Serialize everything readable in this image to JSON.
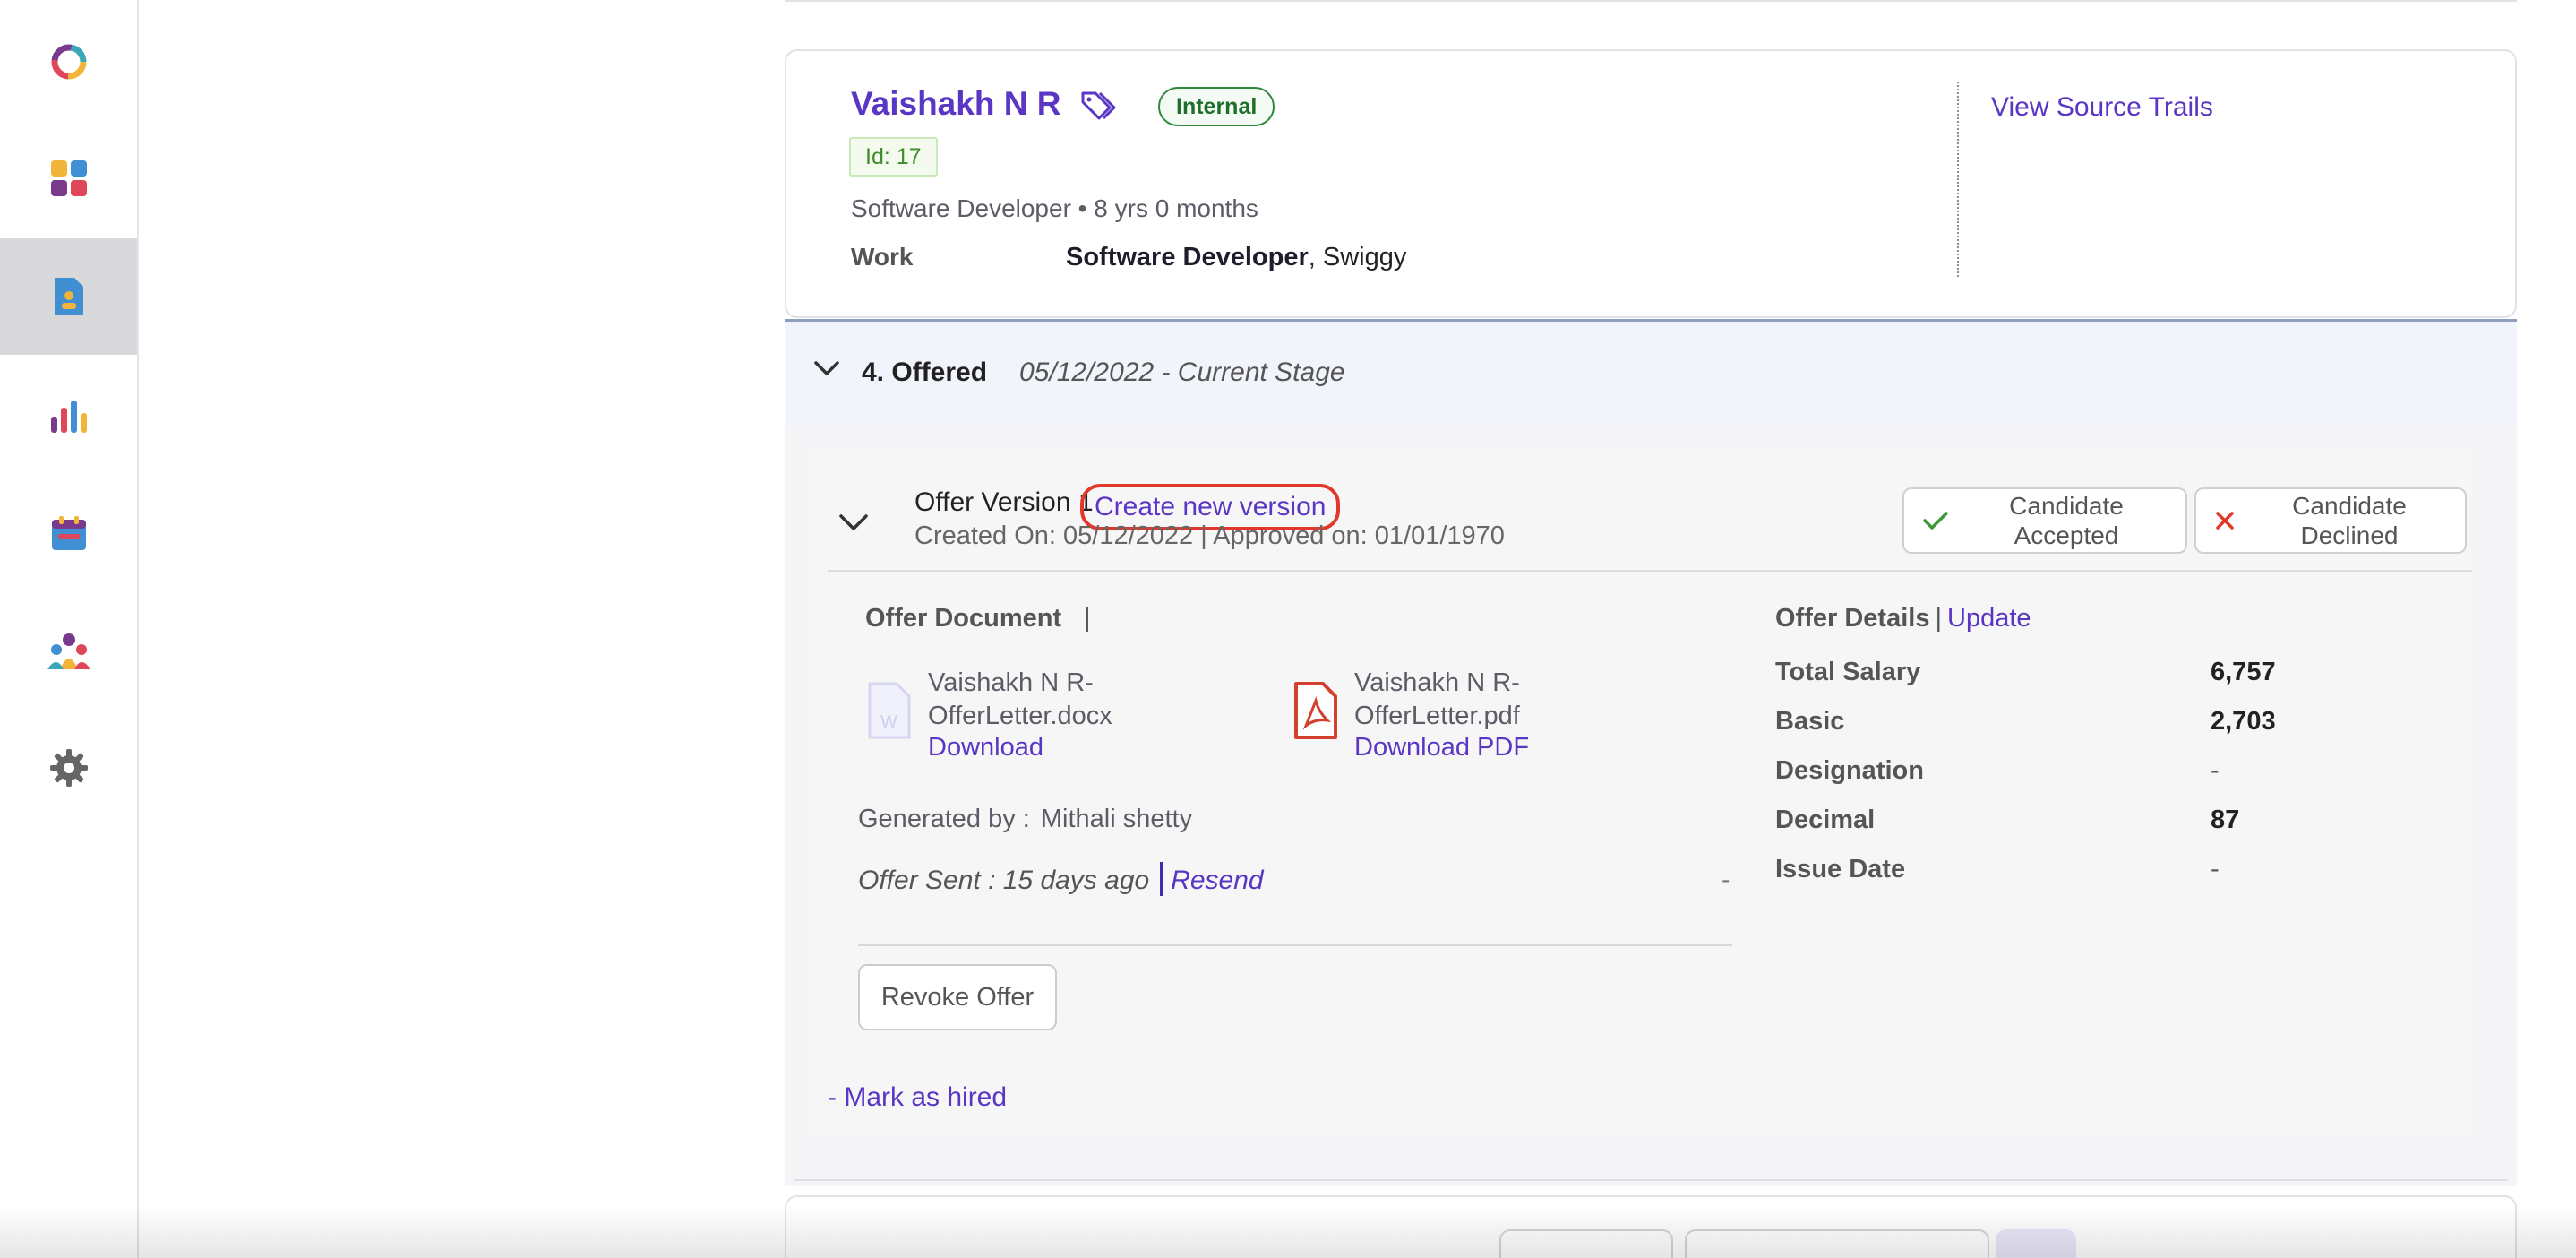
{
  "rail": {
    "items": [
      {
        "icon": "logo-ring-icon"
      },
      {
        "icon": "dashboard-grid-icon"
      },
      {
        "icon": "candidate-document-icon",
        "active": true
      },
      {
        "icon": "analytics-bars-icon"
      },
      {
        "icon": "calendar-icon"
      },
      {
        "icon": "team-people-icon"
      },
      {
        "icon": "settings-gear-icon"
      }
    ],
    "colors": {
      "purple": "#7a3a8c",
      "yellow": "#f2b53a",
      "red": "#e0465a",
      "blue": "#3f8fd2",
      "teal": "#3aa8b8"
    }
  },
  "candidate": {
    "name": "Vaishakh N R",
    "internal_badge": "Internal",
    "id_label": "Id: 17",
    "role_summary": "Software Developer • 8 yrs 0 months",
    "work_label": "Work",
    "work_title": "Software Developer",
    "work_company": ", Swiggy",
    "source_trails_link": "View Source Trails"
  },
  "stage": {
    "title": "4. Offered",
    "date_status": "05/12/2022 - Current Stage"
  },
  "offer": {
    "version_label": "Offer Version 1",
    "create_version_link": "Create new version",
    "created_approved": "Created On: 05/12/2022 | Approved on: 01/01/1970",
    "accept_button": "Candidate Accepted",
    "decline_button": "Candidate Declined",
    "document_heading": "Offer Document",
    "document_pipe": "|",
    "files": {
      "docx": {
        "name": "Vaishakh N R-OfferLetter.docx",
        "action": "Download"
      },
      "pdf": {
        "name": "Vaishakh N R-OfferLetter.pdf",
        "action": "Download PDF"
      }
    },
    "generated_label": "Generated by :",
    "generated_by": "Mithali shetty",
    "sent_label": "Offer Sent : 15 days ago",
    "resend_link": "Resend",
    "dash": "-",
    "revoke_button": "Revoke Offer",
    "mark_hired_link": "- Mark as hired",
    "details_heading": "Offer Details",
    "details_pipe": "|",
    "update_link": "Update",
    "details": [
      {
        "label": "Total Salary",
        "value": "6,757"
      },
      {
        "label": "Basic",
        "value": "2,703"
      },
      {
        "label": "Designation",
        "value": "-"
      },
      {
        "label": "Decimal",
        "value": "87"
      },
      {
        "label": "Issue Date",
        "value": "-"
      }
    ]
  },
  "theme": {
    "accent": "#5a36c4",
    "success": "#2d8a3a",
    "danger": "#e0392c"
  }
}
